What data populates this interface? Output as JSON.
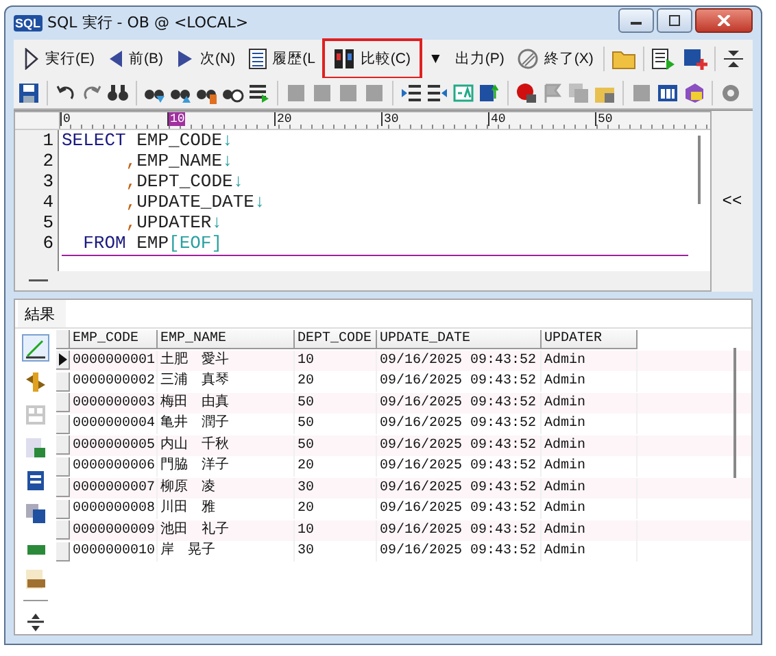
{
  "window": {
    "icon_label": "SQL",
    "title": "SQL 実行 - OB @ <LOCAL>"
  },
  "toolbar": [
    {
      "kind": "run",
      "label": "実行(E)",
      "highlighted": false
    },
    {
      "kind": "prev",
      "label": "前(B)",
      "highlighted": false
    },
    {
      "kind": "next",
      "label": "次(N)",
      "highlighted": false
    },
    {
      "kind": "history",
      "label": "履歴(L",
      "highlighted": false
    },
    {
      "kind": "compare",
      "label": "比較(C)",
      "highlighted": true
    },
    {
      "kind": "text",
      "label": "▼",
      "highlighted": false
    },
    {
      "kind": "text",
      "label": "出力(P)",
      "highlighted": false
    },
    {
      "kind": "stop",
      "label": "終了(X)",
      "highlighted": false
    }
  ],
  "ruler": [
    {
      "label": "0",
      "selected": false
    },
    {
      "label": "10",
      "selected": true
    },
    {
      "label": "20",
      "selected": false
    },
    {
      "label": "30",
      "selected": false
    },
    {
      "label": "40",
      "selected": false
    },
    {
      "label": "50",
      "selected": false
    }
  ],
  "editor": {
    "lines": [
      {
        "number": "1",
        "tokens": [
          {
            "kind": "keyword",
            "text": "SELECT"
          },
          {
            "kind": "plain",
            "text": " EMP_CODE"
          },
          {
            "kind": "eol",
            "text": "↓"
          }
        ]
      },
      {
        "number": "2",
        "tokens": [
          {
            "kind": "comma",
            "text": "      ,"
          },
          {
            "kind": "plain",
            "text": "EMP_NAME"
          },
          {
            "kind": "eol",
            "text": "↓"
          }
        ]
      },
      {
        "number": "3",
        "tokens": [
          {
            "kind": "comma",
            "text": "      ,"
          },
          {
            "kind": "plain",
            "text": "DEPT_CODE"
          },
          {
            "kind": "eol",
            "text": "↓"
          }
        ]
      },
      {
        "number": "4",
        "tokens": [
          {
            "kind": "comma",
            "text": "      ,"
          },
          {
            "kind": "plain",
            "text": "UPDATE_DATE"
          },
          {
            "kind": "eol",
            "text": "↓"
          }
        ]
      },
      {
        "number": "5",
        "tokens": [
          {
            "kind": "comma",
            "text": "      ,"
          },
          {
            "kind": "plain",
            "text": "UPDATER"
          },
          {
            "kind": "eol",
            "text": "↓"
          }
        ]
      },
      {
        "number": "6",
        "tokens": [
          {
            "kind": "keyword",
            "text": "  FROM"
          },
          {
            "kind": "plain",
            "text": " EMP"
          },
          {
            "kind": "eol",
            "text": "[EOF]"
          }
        ]
      }
    ],
    "collapse_label": "<<"
  },
  "results": {
    "tabs": [
      {
        "label": "結果",
        "selected": true
      }
    ],
    "columns": [
      "EMP_CODE",
      "EMP_NAME",
      "DEPT_CODE",
      "UPDATE_DATE",
      "UPDATER"
    ],
    "rows": [
      {
        "selected": true,
        "cells": [
          "0000000001",
          "土肥　愛斗",
          "10",
          "09/16/2025 09:43:52",
          "Admin"
        ]
      },
      {
        "selected": false,
        "cells": [
          "0000000002",
          "三浦　真琴",
          "20",
          "09/16/2025 09:43:52",
          "Admin"
        ]
      },
      {
        "selected": false,
        "cells": [
          "0000000003",
          "梅田　由真",
          "50",
          "09/16/2025 09:43:52",
          "Admin"
        ]
      },
      {
        "selected": false,
        "cells": [
          "0000000004",
          "亀井　潤子",
          "50",
          "09/16/2025 09:43:52",
          "Admin"
        ]
      },
      {
        "selected": false,
        "cells": [
          "0000000005",
          "内山　千秋",
          "50",
          "09/16/2025 09:43:52",
          "Admin"
        ]
      },
      {
        "selected": false,
        "cells": [
          "0000000006",
          "門脇　洋子",
          "20",
          "09/16/2025 09:43:52",
          "Admin"
        ]
      },
      {
        "selected": false,
        "cells": [
          "0000000007",
          "柳原　凌",
          "30",
          "09/16/2025 09:43:52",
          "Admin"
        ]
      },
      {
        "selected": false,
        "cells": [
          "0000000008",
          "川田　雅",
          "20",
          "09/16/2025 09:43:52",
          "Admin"
        ]
      },
      {
        "selected": false,
        "cells": [
          "0000000009",
          "池田　礼子",
          "10",
          "09/16/2025 09:43:52",
          "Admin"
        ]
      },
      {
        "selected": false,
        "cells": [
          "0000000010",
          "岸　晃子",
          "30",
          "09/16/2025 09:43:52",
          "Admin"
        ]
      }
    ]
  }
}
